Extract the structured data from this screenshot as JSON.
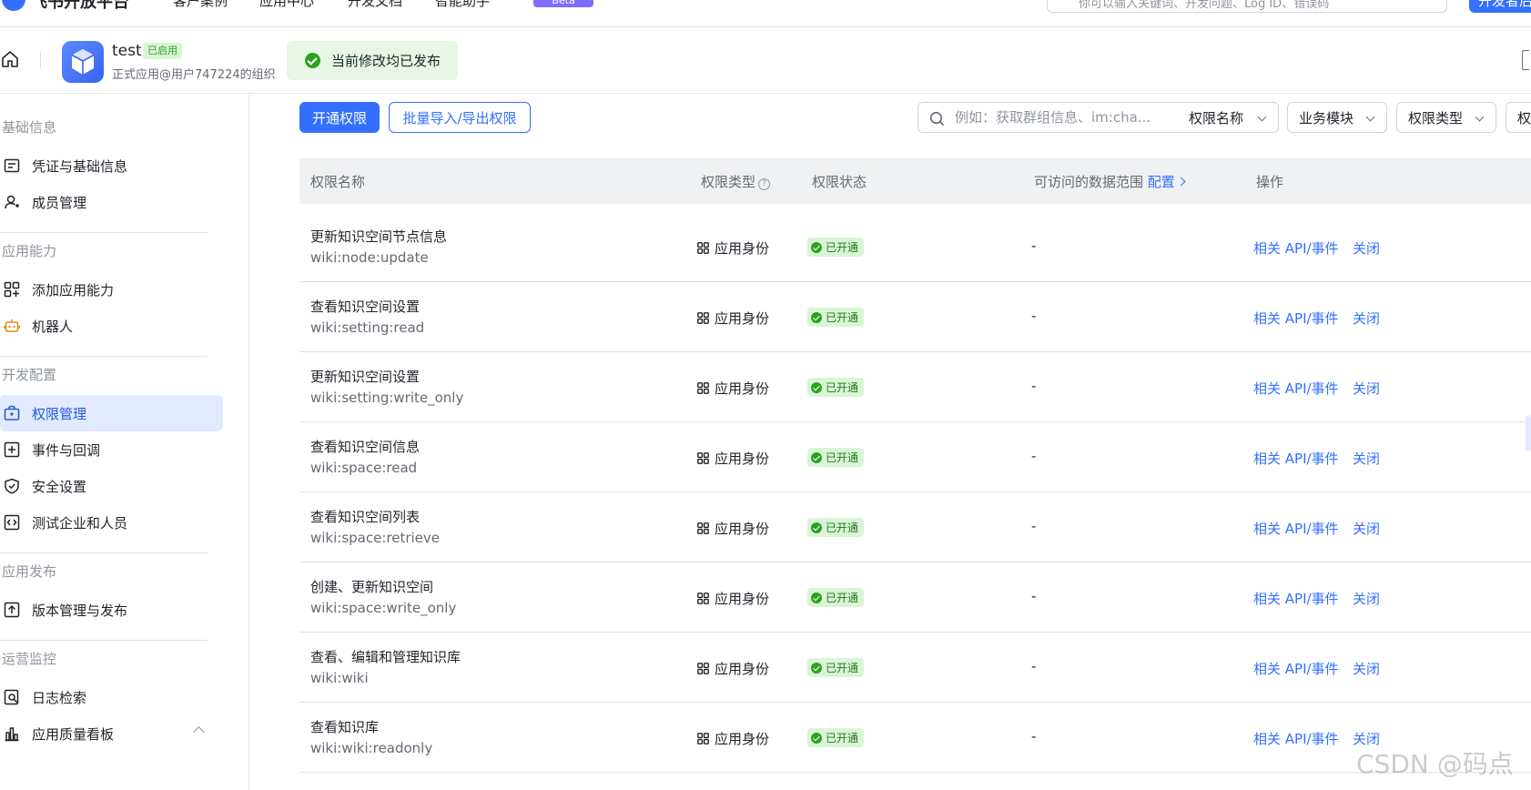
{
  "topnav": {
    "brand": "飞书开放平台",
    "links": [
      "客户案例",
      "应用中心",
      "开发文档",
      "智能助手"
    ],
    "beta_badge": "Beta",
    "search_placeholder": "你可以输入关键词、开发问题、Log ID、错误码",
    "dev_button": "开发者后台"
  },
  "app": {
    "name": "test",
    "status_badge": "已启用",
    "org": "正式应用@用户747224的组织",
    "toast": "当前修改均已发布"
  },
  "sidebar": {
    "sections": [
      {
        "title": "基础信息",
        "items": [
          {
            "label": "凭证与基础信息",
            "icon": "credential-icon"
          },
          {
            "label": "成员管理",
            "icon": "member-icon"
          }
        ]
      },
      {
        "title": "应用能力",
        "items": [
          {
            "label": "添加应用能力",
            "icon": "add-capability-icon"
          },
          {
            "label": "机器人",
            "icon": "robot-icon"
          }
        ]
      },
      {
        "title": "开发配置",
        "items": [
          {
            "label": "权限管理",
            "icon": "permission-icon",
            "active": true
          },
          {
            "label": "事件与回调",
            "icon": "event-icon"
          },
          {
            "label": "安全设置",
            "icon": "shield-icon"
          },
          {
            "label": "测试企业和人员",
            "icon": "test-icon"
          }
        ]
      },
      {
        "title": "应用发布",
        "items": [
          {
            "label": "版本管理与发布",
            "icon": "upload-icon"
          }
        ]
      },
      {
        "title": "运营监控",
        "items": [
          {
            "label": "日志检索",
            "icon": "log-search-icon"
          },
          {
            "label": "应用质量看板",
            "icon": "chart-icon"
          }
        ]
      }
    ]
  },
  "toolbar": {
    "open_permission": "开通权限",
    "batch_import_export": "批量导入/导出权限",
    "search_placeholder": "例如：获取群组信息、im:cha...",
    "filter_name": "权限名称",
    "filter_module": "业务模块",
    "filter_type": "权限类型",
    "filter_extra": "权"
  },
  "table": {
    "headers": {
      "name": "权限名称",
      "type": "权限类型",
      "type_help": "?",
      "status": "权限状态",
      "range": "可访问的数据范围",
      "range_config": "配置",
      "action": "操作"
    },
    "rows": [
      {
        "name": "更新知识空间节点信息",
        "code": "wiki:node:update",
        "type": "应用身份",
        "status": "已开通",
        "range": "-",
        "api": "相关 API/事件",
        "close": "关闭"
      },
      {
        "name": "查看知识空间设置",
        "code": "wiki:setting:read",
        "type": "应用身份",
        "status": "已开通",
        "range": "-",
        "api": "相关 API/事件",
        "close": "关闭"
      },
      {
        "name": "更新知识空间设置",
        "code": "wiki:setting:write_only",
        "type": "应用身份",
        "status": "已开通",
        "range": "-",
        "api": "相关 API/事件",
        "close": "关闭"
      },
      {
        "name": "查看知识空间信息",
        "code": "wiki:space:read",
        "type": "应用身份",
        "status": "已开通",
        "range": "-",
        "api": "相关 API/事件",
        "close": "关闭"
      },
      {
        "name": "查看知识空间列表",
        "code": "wiki:space:retrieve",
        "type": "应用身份",
        "status": "已开通",
        "range": "-",
        "api": "相关 API/事件",
        "close": "关闭"
      },
      {
        "name": "创建、更新知识空间",
        "code": "wiki:space:write_only",
        "type": "应用身份",
        "status": "已开通",
        "range": "-",
        "api": "相关 API/事件",
        "close": "关闭"
      },
      {
        "name": "查看、编辑和管理知识库",
        "code": "wiki:wiki",
        "type": "应用身份",
        "status": "已开通",
        "range": "-",
        "api": "相关 API/事件",
        "close": "关闭"
      },
      {
        "name": "查看知识库",
        "code": "wiki:wiki:readonly",
        "type": "应用身份",
        "status": "已开通",
        "range": "-",
        "api": "相关 API/事件",
        "close": "关闭"
      }
    ]
  },
  "watermark": "CSDN @码点"
}
